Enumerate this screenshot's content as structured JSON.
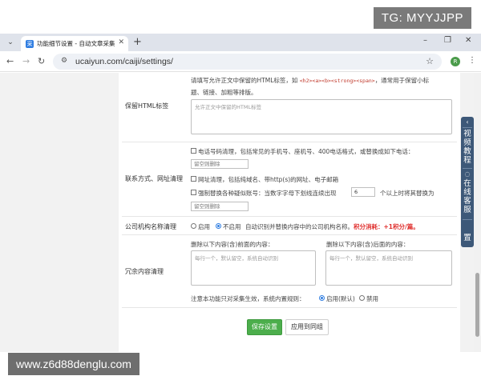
{
  "watermarks": {
    "top_right": "TG: MYYJJPP",
    "bottom_left": "www.z6d88denglu.com"
  },
  "browser": {
    "tab_title": "功能细节设置 - 自动文章采集",
    "url": "ucaiyun.com/caiji/settings/",
    "profile_initial": "R"
  },
  "html_tags": {
    "label": "保留HTML标签",
    "desc_prefix": "请填写允许正文中保留的HTML标签，如",
    "desc_tags": "<h2><a><b><strong><span>",
    "desc_suffix": "，通常用于保留小标",
    "desc_line2": "题、链接、加粗等排版。",
    "placeholder": "允许正文中保留的HTML标签"
  },
  "contact": {
    "label": "联系方式、网址清理",
    "phone_option": "电话号码清理，包括常见的手机号、座机号、400电话格式，或替换成如下电话：",
    "phone_placeholder": "留空则删除",
    "url_option": "网址清理，包括纯域名、带http(s)的网址、电子邮箱",
    "force_prefix": "强制替换各种疑似账号：当数字字母下划线连续出现",
    "force_count": "6",
    "force_suffix": "个以上时将其替换为",
    "force_placeholder": "留空则删除"
  },
  "company": {
    "label": "公司机构名称清理",
    "enable": "启用",
    "disable": "不启用",
    "desc": "自动识别并替换内容中的公司机构名称。",
    "points": "积分消耗：+1积分/篇。"
  },
  "redundant": {
    "label": "冗余内容清理",
    "before_label": "删除以下内容(含)前面的内容：",
    "after_label": "删除以下内容(含)后面的内容：",
    "placeholder": "每行一个，默认留空，系统自动识别",
    "note": "注意本功能只对采集生效，系统内置规则：",
    "opt_enable": "启用(默认)",
    "opt_disable": "禁用"
  },
  "buttons": {
    "save": "保存设置",
    "apply": "应用到同组"
  },
  "side_float": {
    "tutorial": "视频教程",
    "service": "在线客服",
    "top": "置"
  }
}
